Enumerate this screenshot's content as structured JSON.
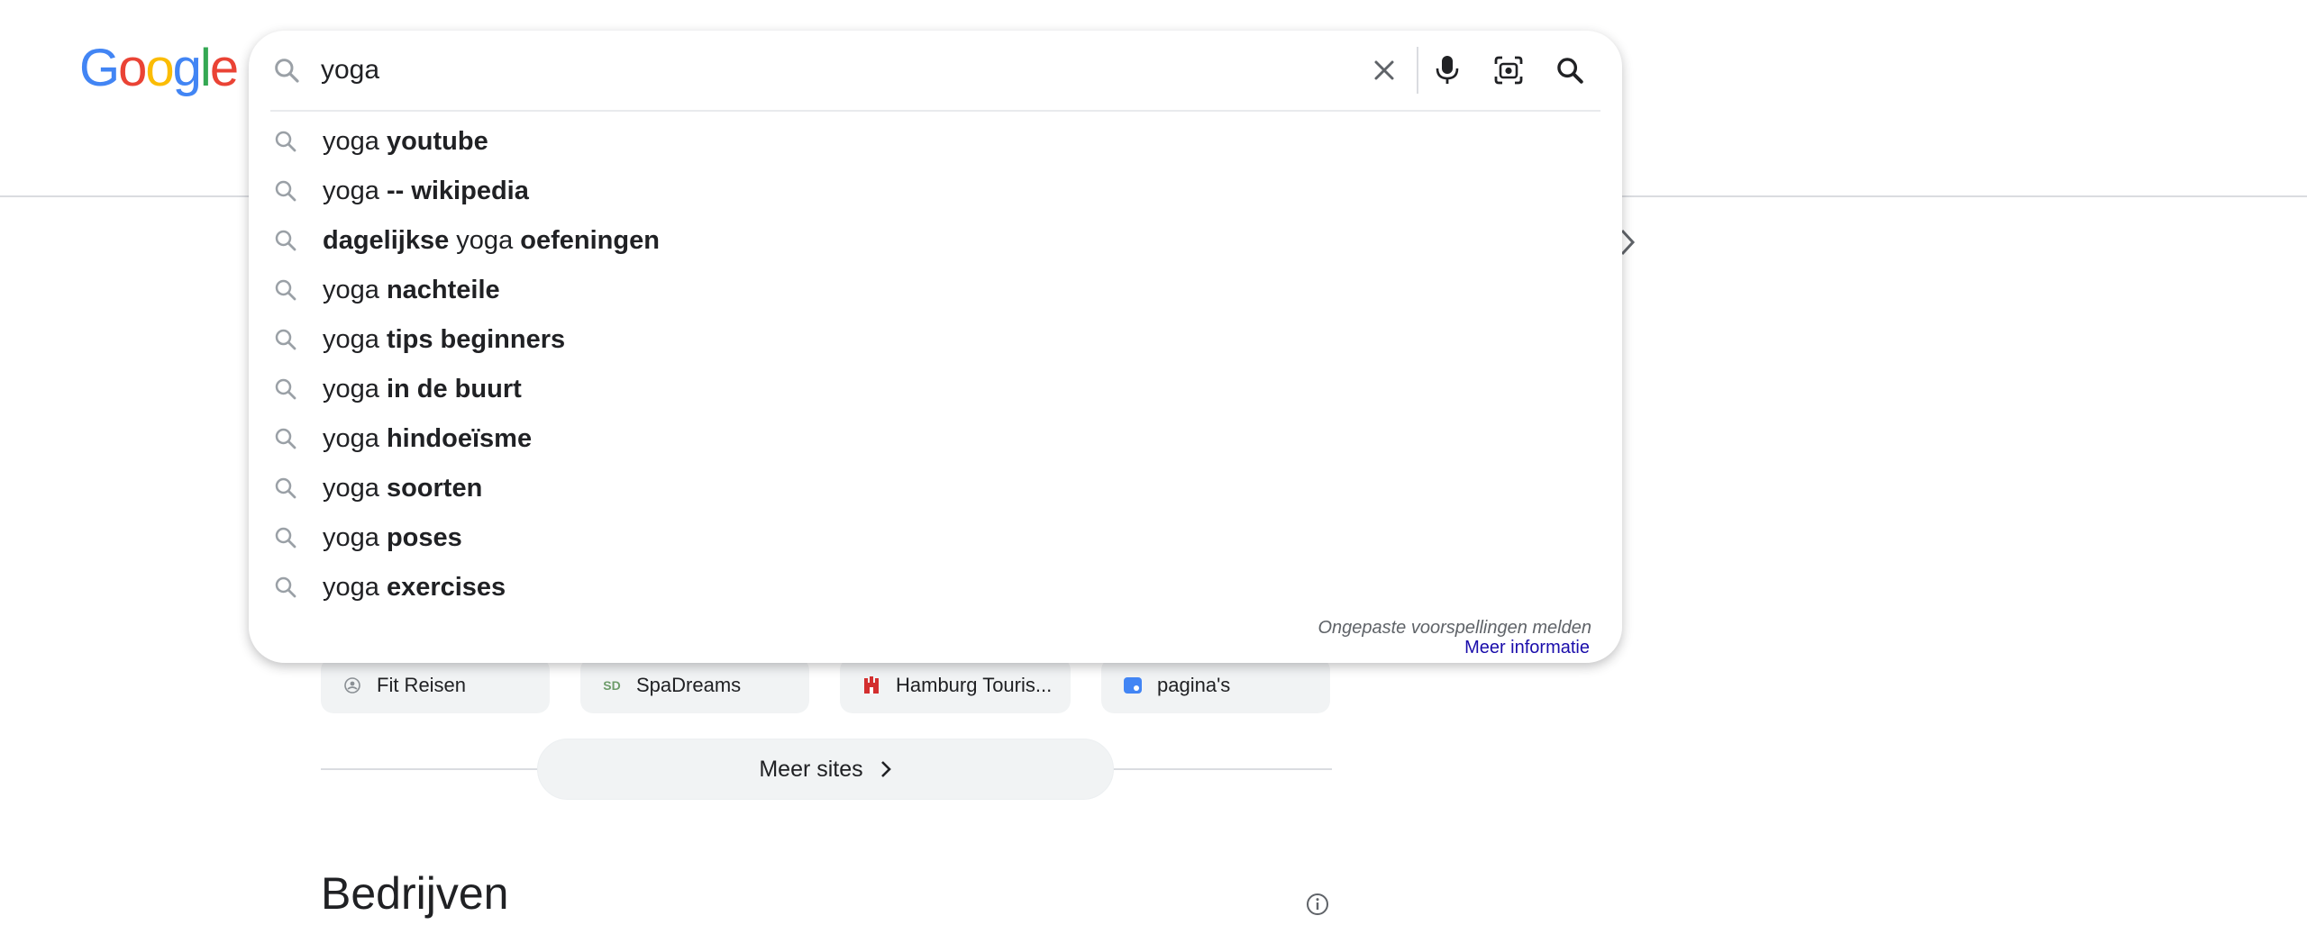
{
  "logo": {
    "letters": [
      {
        "char": "G",
        "color": "#4285F4"
      },
      {
        "char": "o",
        "color": "#EA4335"
      },
      {
        "char": "o",
        "color": "#FBBC05"
      },
      {
        "char": "g",
        "color": "#4285F4"
      },
      {
        "char": "l",
        "color": "#34A853"
      },
      {
        "char": "e",
        "color": "#EA4335"
      }
    ]
  },
  "search": {
    "query": "yoga"
  },
  "suggestions": [
    {
      "parts": [
        {
          "text": "yoga",
          "bold": false
        },
        {
          "text": " youtube",
          "bold": true
        }
      ]
    },
    {
      "parts": [
        {
          "text": "yoga",
          "bold": false
        },
        {
          "text": " -- wikipedia",
          "bold": true
        }
      ]
    },
    {
      "parts": [
        {
          "text": "dagelijkse",
          "bold": true
        },
        {
          "text": " yoga ",
          "bold": false
        },
        {
          "text": "oefeningen",
          "bold": true
        }
      ]
    },
    {
      "parts": [
        {
          "text": "yoga",
          "bold": false
        },
        {
          "text": " nachteile",
          "bold": true
        }
      ]
    },
    {
      "parts": [
        {
          "text": "yoga",
          "bold": false
        },
        {
          "text": " tips beginners",
          "bold": true
        }
      ]
    },
    {
      "parts": [
        {
          "text": "yoga",
          "bold": false
        },
        {
          "text": " in de buurt",
          "bold": true
        }
      ]
    },
    {
      "parts": [
        {
          "text": "yoga",
          "bold": false
        },
        {
          "text": " hindoeïsme",
          "bold": true
        }
      ]
    },
    {
      "parts": [
        {
          "text": "yoga",
          "bold": false
        },
        {
          "text": " soorten",
          "bold": true
        }
      ]
    },
    {
      "parts": [
        {
          "text": "yoga",
          "bold": false
        },
        {
          "text": " poses",
          "bold": true
        }
      ]
    },
    {
      "parts": [
        {
          "text": "yoga",
          "bold": false
        },
        {
          "text": " exercises",
          "bold": true
        }
      ]
    }
  ],
  "footer": {
    "report": "Ongepaste voorspellingen melden",
    "learn_more": "Meer informatie"
  },
  "chips": [
    {
      "label": "Fit Reisen",
      "icon": "fit-reisen-favicon"
    },
    {
      "label": "SpaDreams",
      "icon": "spadreams-favicon",
      "icon_text": "SD"
    },
    {
      "label": "Hamburg Touris...",
      "icon": "hamburg-favicon"
    },
    {
      "label": "pagina's",
      "icon": "pages-favicon"
    }
  ],
  "more_sites": "Meer sites",
  "section_heading": "Bedrijven"
}
